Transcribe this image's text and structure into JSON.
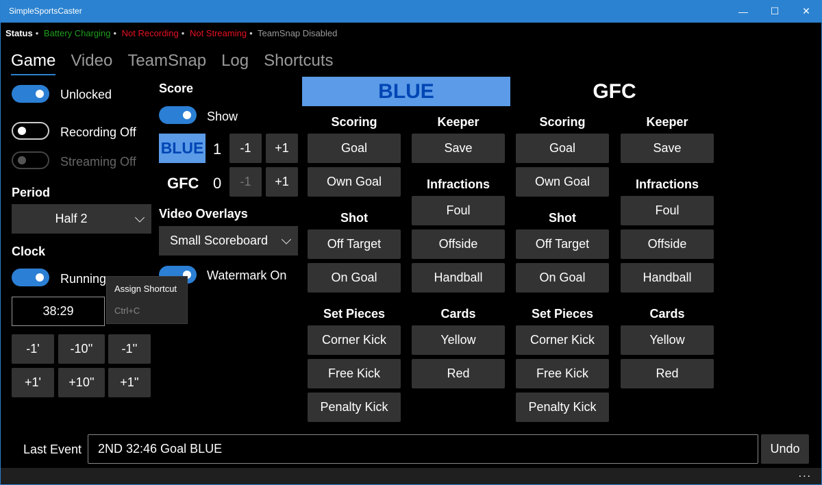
{
  "window": {
    "title": "SimpleSportsCaster",
    "controls": {
      "minimize": "—",
      "maximize": "☐",
      "close": "✕"
    }
  },
  "status": {
    "label": "Status",
    "separator": "•",
    "items": [
      {
        "text": "Battery Charging",
        "color": "#1f9e1f"
      },
      {
        "text": "Not Recording",
        "color": "#e81123"
      },
      {
        "text": "Not Streaming",
        "color": "#e81123"
      },
      {
        "text": "TeamSnap Disabled",
        "color": "#9a9a9a"
      }
    ]
  },
  "tabs": [
    {
      "label": "Game",
      "active": true
    },
    {
      "label": "Video",
      "active": false
    },
    {
      "label": "TeamSnap",
      "active": false
    },
    {
      "label": "Log",
      "active": false
    },
    {
      "label": "Shortcuts",
      "active": false
    }
  ],
  "left": {
    "toggles": [
      {
        "label": "Unlocked",
        "state": "on"
      },
      {
        "label": "Recording Off",
        "state": "off"
      },
      {
        "label": "Streaming Off",
        "state": "disabled"
      }
    ],
    "period": {
      "heading": "Period",
      "selected": "Half 2"
    },
    "clock": {
      "heading": "Clock",
      "toggle_label": "Running",
      "time": "38:29",
      "adjust_buttons": [
        "-1'",
        "-10''",
        "-1''",
        "+1'",
        "+10''",
        "+1''"
      ]
    },
    "tooltip": {
      "title": "Assign Shortcut",
      "shortcut": "Ctrl+C"
    }
  },
  "score": {
    "heading": "Score",
    "show_label": "Show",
    "teams": [
      {
        "name": "BLUE",
        "score": "1",
        "minus": "-1",
        "plus": "+1",
        "minus_enabled": true
      },
      {
        "name": "GFC",
        "score": "0",
        "minus": "-1",
        "plus": "+1",
        "minus_enabled": false
      }
    ],
    "overlays": {
      "heading": "Video Overlays",
      "selected": "Small Scoreboard"
    },
    "watermark_label": "Watermark On"
  },
  "teams": [
    {
      "name": "BLUE",
      "accent": "#5b9be8",
      "sections": {
        "scoring": {
          "heading": "Scoring",
          "buttons": [
            "Goal",
            "Own Goal"
          ]
        },
        "shot": {
          "heading": "Shot",
          "buttons": [
            "Off Target",
            "On Goal"
          ]
        },
        "set_pieces": {
          "heading": "Set Pieces",
          "buttons": [
            "Corner Kick",
            "Free Kick",
            "Penalty Kick"
          ]
        },
        "keeper": {
          "heading": "Keeper",
          "buttons": [
            "Save"
          ]
        },
        "infractions": {
          "heading": "Infractions",
          "buttons": [
            "Foul",
            "Offside",
            "Handball"
          ]
        },
        "cards": {
          "heading": "Cards",
          "buttons": [
            "Yellow",
            "Red"
          ]
        }
      }
    },
    {
      "name": "GFC",
      "accent": "#000000",
      "sections": {
        "scoring": {
          "heading": "Scoring",
          "buttons": [
            "Goal",
            "Own Goal"
          ]
        },
        "shot": {
          "heading": "Shot",
          "buttons": [
            "Off Target",
            "On Goal"
          ]
        },
        "set_pieces": {
          "heading": "Set Pieces",
          "buttons": [
            "Corner Kick",
            "Free Kick",
            "Penalty Kick"
          ]
        },
        "keeper": {
          "heading": "Keeper",
          "buttons": [
            "Save"
          ]
        },
        "infractions": {
          "heading": "Infractions",
          "buttons": [
            "Foul",
            "Offside",
            "Handball"
          ]
        },
        "cards": {
          "heading": "Cards",
          "buttons": [
            "Yellow",
            "Red"
          ]
        }
      }
    }
  ],
  "footer": {
    "last_event_label": "Last Event",
    "last_event_value": "2ND 32:46 Goal BLUE",
    "undo_label": "Undo",
    "more_label": "..."
  }
}
